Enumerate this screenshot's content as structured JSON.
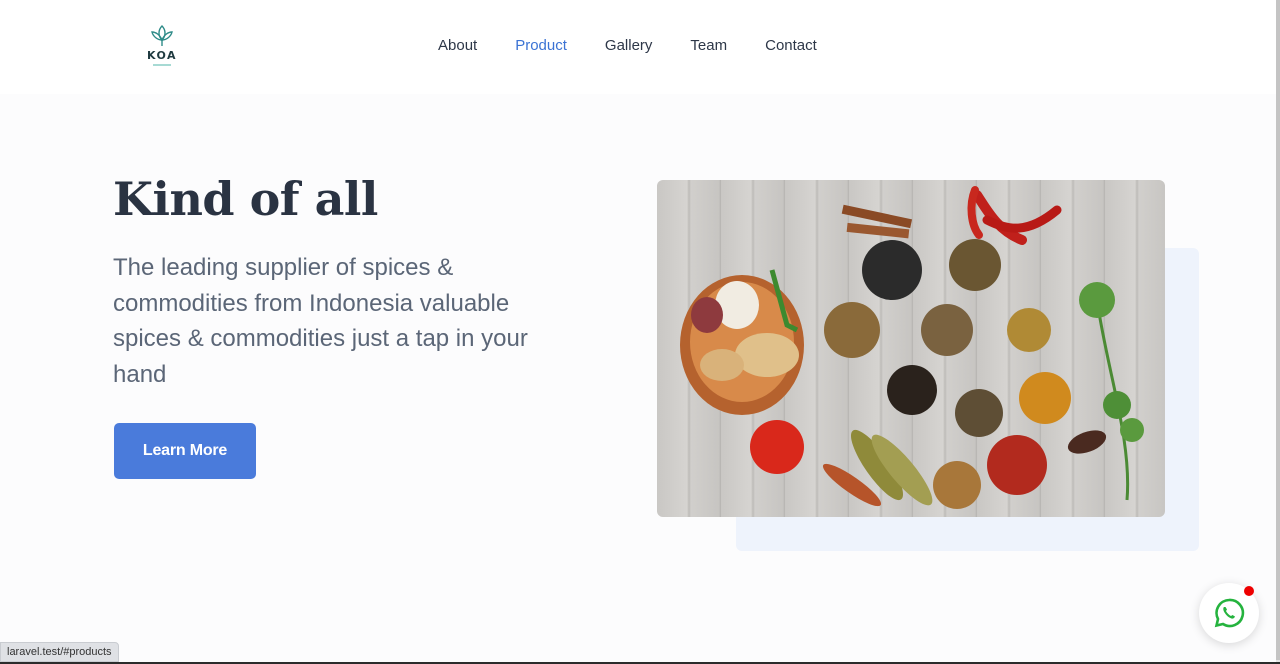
{
  "brand": {
    "name": "KOA",
    "logo_icon": "leaf-icon",
    "accent": "#2e8b88"
  },
  "nav": {
    "items": [
      {
        "label": "About"
      },
      {
        "label": "Product",
        "active": true
      },
      {
        "label": "Gallery"
      },
      {
        "label": "Team"
      },
      {
        "label": "Contact"
      }
    ]
  },
  "hero": {
    "title": "Kind of all",
    "description": "The leading supplier of spices & commodities from Indonesia valuable spices & commodities just a tap in your hand",
    "cta_label": "Learn More",
    "image_icon": "spices-photo"
  },
  "status_bar": {
    "url": "laravel.test/#products"
  },
  "whatsapp": {
    "icon": "whatsapp-icon",
    "badge_color": "#ee0000"
  },
  "colors": {
    "primary": "#4a7bdb",
    "active_nav": "#3b73d4",
    "title": "#2a3342",
    "text": "#5b6677"
  }
}
